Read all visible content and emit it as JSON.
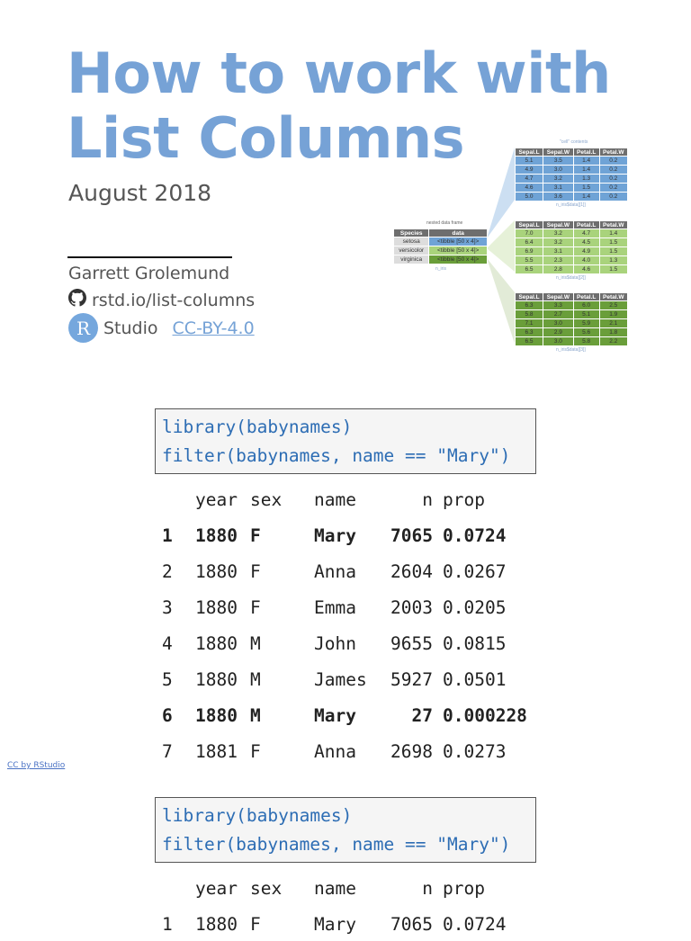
{
  "title": [
    "How to work with",
    "List Columns"
  ],
  "date": "August 2018",
  "author": "Garrett Grolemund",
  "github_link": "rstd.io/list-columns",
  "rstudio": {
    "logo_letter": "R",
    "logo_text": "Studio",
    "license": "CC-BY-4.0"
  },
  "footer_link": "CC by RStudio",
  "diagram": {
    "top_caption": "\"cell\" contents",
    "nested_caption": "nested data frame",
    "nested_sub": "n_iris",
    "nested_headers": [
      "Species",
      "data"
    ],
    "nested_rows": [
      [
        "setosa",
        "<tibble [50 x 4]>"
      ],
      [
        "versicolor",
        "<tibble [50 x 4]>"
      ],
      [
        "virginica",
        "<tibble [50 x 4]>"
      ]
    ],
    "colors": [
      "#6fa3d6",
      "#a9d37c",
      "#6a9e3a"
    ],
    "headers": [
      "Sepal.L",
      "Sepal.W",
      "Petal.L",
      "Petal.W"
    ],
    "tables": [
      {
        "caption": "n_iris$data[[1]]",
        "rows": [
          [
            "5.1",
            "3.5",
            "1.4",
            "0.2"
          ],
          [
            "4.9",
            "3.0",
            "1.4",
            "0.2"
          ],
          [
            "4.7",
            "3.2",
            "1.3",
            "0.2"
          ],
          [
            "4.6",
            "3.1",
            "1.5",
            "0.2"
          ],
          [
            "5.0",
            "3.6",
            "1.4",
            "0.2"
          ]
        ]
      },
      {
        "caption": "n_iris$data[[2]]",
        "rows": [
          [
            "7.0",
            "3.2",
            "4.7",
            "1.4"
          ],
          [
            "6.4",
            "3.2",
            "4.5",
            "1.5"
          ],
          [
            "6.9",
            "3.1",
            "4.9",
            "1.5"
          ],
          [
            "5.5",
            "2.3",
            "4.0",
            "1.3"
          ],
          [
            "6.5",
            "2.8",
            "4.6",
            "1.5"
          ]
        ]
      },
      {
        "caption": "n_iris$data[[3]]",
        "rows": [
          [
            "6.3",
            "3.3",
            "6.0",
            "2.5"
          ],
          [
            "5.8",
            "2.7",
            "5.1",
            "1.9"
          ],
          [
            "7.1",
            "3.0",
            "5.9",
            "2.1"
          ],
          [
            "6.3",
            "2.9",
            "5.6",
            "1.8"
          ],
          [
            "6.5",
            "3.0",
            "5.8",
            "2.2"
          ]
        ]
      }
    ]
  },
  "code_blocks": [
    {
      "lines": [
        "library(babynames)",
        "filter(babynames, name == \"Mary\")"
      ]
    },
    {
      "lines": [
        "library(babynames)",
        "filter(babynames, name == \"Mary\")"
      ]
    }
  ],
  "table1": {
    "headers": [
      "year",
      "sex",
      "name",
      "n",
      "prop"
    ],
    "rows": [
      [
        "1",
        "1880",
        "F",
        "Mary",
        "7065",
        "0.0724"
      ],
      [
        "2",
        "1880",
        "F",
        "Anna",
        "2604",
        "0.0267"
      ],
      [
        "3",
        "1880",
        "F",
        "Emma",
        "2003",
        "0.0205"
      ],
      [
        "4",
        "1880",
        "M",
        "John",
        "9655",
        "0.0815"
      ],
      [
        "5",
        "1880",
        "M",
        "James",
        "5927",
        "0.0501"
      ],
      [
        "6",
        "1880",
        "M",
        "Mary",
        "27",
        "0.000228"
      ],
      [
        "7",
        "1881",
        "F",
        "Anna",
        "2698",
        "0.0273"
      ]
    ]
  },
  "table2": {
    "headers": [
      "year",
      "sex",
      "name",
      "n",
      "prop"
    ],
    "rows": [
      [
        "1",
        "1880",
        "F",
        "Mary",
        "7065",
        "0.0724"
      ]
    ]
  }
}
